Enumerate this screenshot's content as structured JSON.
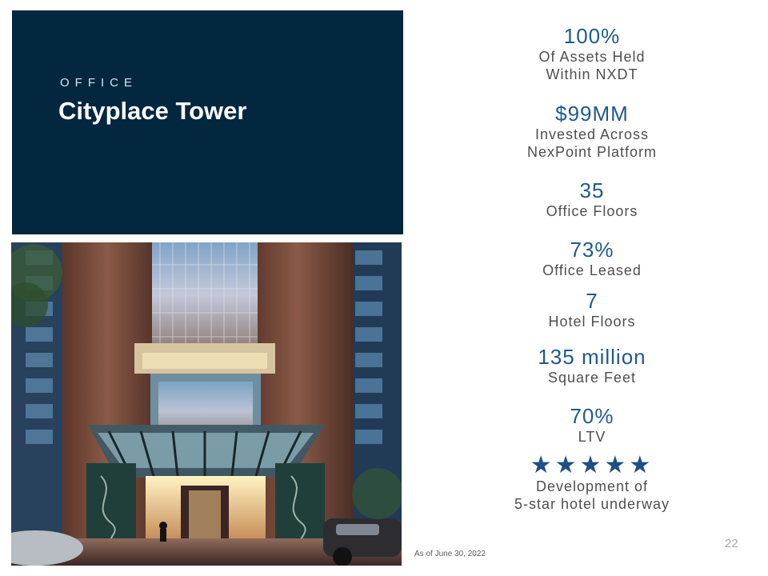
{
  "hero": {
    "eyebrow": "OFFICE",
    "title": "Cityplace Tower"
  },
  "stats": [
    {
      "value": "100%",
      "label_lines": [
        "Of Assets Held",
        "Within NXDT"
      ]
    },
    {
      "value": "$99MM",
      "label_lines": [
        "Invested Across",
        "NexPoint Platform"
      ]
    },
    {
      "value": "35",
      "label_lines": [
        "Office Floors"
      ]
    },
    {
      "value": "73%",
      "label_lines": [
        "Office Leased"
      ]
    },
    {
      "value": "7",
      "label_lines": [
        "Hotel Floors"
      ]
    },
    {
      "value": "135 million",
      "label_lines": [
        "Square Feet"
      ]
    },
    {
      "value": "70%",
      "label_lines": [
        "LTV"
      ]
    },
    {
      "stars": "★★★★★",
      "label_lines": [
        "Development of",
        "5-star hotel underway"
      ]
    }
  ],
  "footnote": "As of June 30, 2022",
  "page_number": "22",
  "colors": {
    "panel": "#042740",
    "value": "#1f5a8d",
    "label": "#4f4f4f",
    "stars": "#1f4f84"
  },
  "image": {
    "icon": "building-entrance-rendering"
  }
}
